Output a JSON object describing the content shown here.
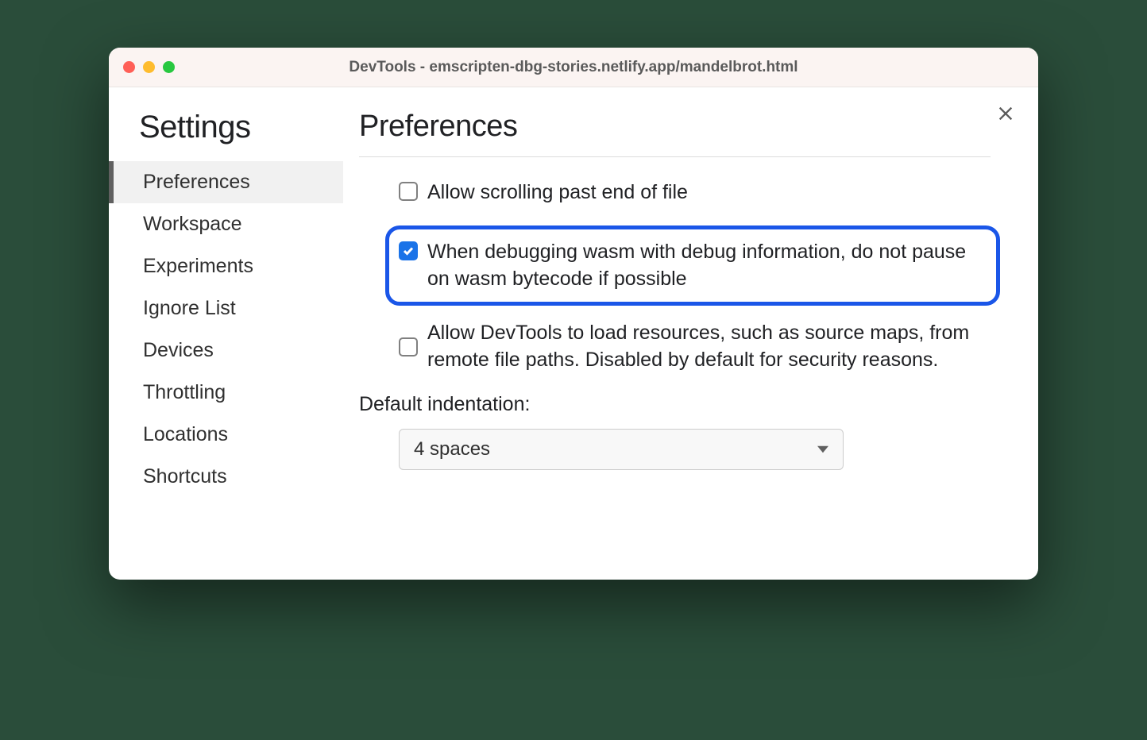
{
  "window": {
    "title": "DevTools - emscripten-dbg-stories.netlify.app/mandelbrot.html"
  },
  "sidebar": {
    "title": "Settings",
    "items": [
      {
        "label": "Preferences",
        "active": true
      },
      {
        "label": "Workspace",
        "active": false
      },
      {
        "label": "Experiments",
        "active": false
      },
      {
        "label": "Ignore List",
        "active": false
      },
      {
        "label": "Devices",
        "active": false
      },
      {
        "label": "Throttling",
        "active": false
      },
      {
        "label": "Locations",
        "active": false
      },
      {
        "label": "Shortcuts",
        "active": false
      }
    ]
  },
  "main": {
    "title": "Preferences",
    "options": {
      "allow_scroll": {
        "label": "Allow scrolling past end of file",
        "checked": false
      },
      "wasm_debug": {
        "label": "When debugging wasm with debug information, do not pause on wasm bytecode if possible",
        "checked": true
      },
      "remote_paths": {
        "label": "Allow DevTools to load resources, such as source maps, from remote file paths. Disabled by default for security reasons.",
        "checked": false
      }
    },
    "indentation": {
      "label": "Default indentation:",
      "value": "4 spaces"
    }
  }
}
